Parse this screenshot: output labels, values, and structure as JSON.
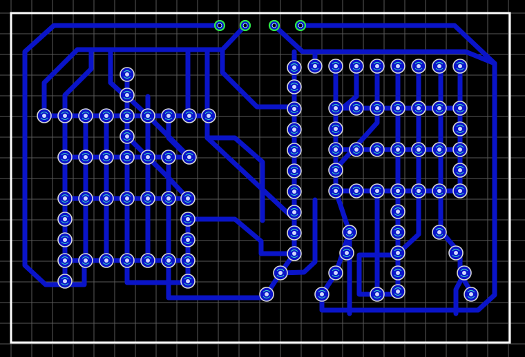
{
  "title": "",
  "colors": {
    "background": "#000000",
    "grid": "#5a5a5a",
    "board_outline": "#ffffff",
    "copper_trace": "#0a14c8",
    "pad_ring": "#d8d8d8",
    "pad_marker": "#35c8c8",
    "header_pad_ring": "#2ee84a"
  },
  "layers": [
    "grid",
    "board-outline",
    "copper-traces",
    "through-hole-pads",
    "header-pads"
  ],
  "grid": {
    "visible": true
  },
  "icons": {
    "pad": "through-hole-pad-icon",
    "header_pad": "header-pad-icon"
  }
}
